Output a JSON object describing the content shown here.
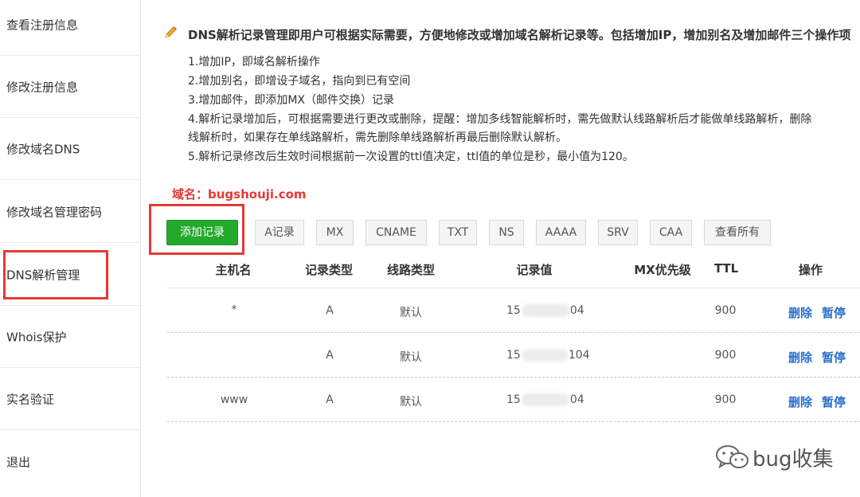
{
  "sidebar": {
    "items": [
      {
        "label": "查看注册信息"
      },
      {
        "label": "修改注册信息"
      },
      {
        "label": "修改域名DNS"
      },
      {
        "label": "修改域名管理密码"
      },
      {
        "label": "DNS解析管理"
      },
      {
        "label": "Whois保护"
      },
      {
        "label": "实名验证"
      },
      {
        "label": "退出"
      }
    ]
  },
  "info": {
    "title": "DNS解析记录管理即用户可根据实际需要，方便地修改或增加域名解析记录等。包括增加IP，增加别名及增加邮件三个操作项",
    "lines": [
      "1.增加IP，即域名解析操作",
      "2.增加别名，即增设子域名，指向到已有空间",
      "3.增加邮件，即添加MX（邮件交换）记录",
      "4.解析记录增加后，可根据需要进行更改或删除，提醒：增加多线智能解析时，需先做默认线路解析后才能做单线路解析，删除",
      "线解析时，如果存在单线路解析，需先删除单线路解析再最后删除默认解析。",
      "5.解析记录修改后生效时间根据前一次设置的ttl值决定，ttl值的单位是秒，最小值为120。"
    ]
  },
  "domain_label": "域名：bugshouji.com",
  "buttons": {
    "add": "添加记录",
    "filters": [
      "A记录",
      "MX",
      "CNAME",
      "TXT",
      "NS",
      "AAAA",
      "SRV",
      "CAA",
      "查看所有"
    ]
  },
  "table": {
    "headers": [
      "主机名",
      "记录类型",
      "线路类型",
      "记录值",
      "MX优先级",
      "TTL",
      "操作"
    ],
    "rows": [
      {
        "host": "*",
        "type": "A",
        "line": "默认",
        "value_prefix": "15",
        "value_suffix": "04",
        "mx": "",
        "ttl": "900",
        "delete": "删除",
        "pause": "暂停"
      },
      {
        "host": "",
        "type": "A",
        "line": "默认",
        "value_prefix": "15",
        "value_suffix": "104",
        "mx": "",
        "ttl": "900",
        "delete": "删除",
        "pause": "暂停"
      },
      {
        "host": "www",
        "type": "A",
        "line": "默认",
        "value_prefix": "15",
        "value_suffix": "04",
        "mx": "",
        "ttl": "900",
        "delete": "删除",
        "pause": "暂停"
      }
    ]
  },
  "watermark": {
    "text": "bug收集",
    "icon": "wechat-icon"
  },
  "colors": {
    "accent_green": "#23a92b",
    "highlight_red": "#e53935",
    "link_blue": "#2a6fcb"
  }
}
